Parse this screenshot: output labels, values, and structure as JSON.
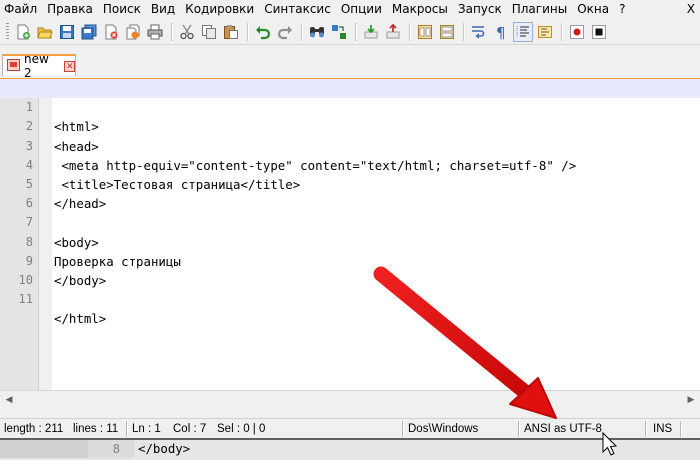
{
  "menu": {
    "items": [
      "Файл",
      "Правка",
      "Поиск",
      "Вид",
      "Кодировки",
      "Синтаксис",
      "Опции",
      "Макросы",
      "Запуск",
      "Плагины",
      "Окна",
      "?"
    ],
    "close": "X"
  },
  "toolbar": {
    "buttons": [
      "new-file-icon",
      "open-file-icon",
      "save-icon",
      "save-all-icon",
      "close-icon",
      "close-all-icon",
      "print-icon",
      "cut-icon",
      "copy-icon",
      "paste-icon",
      "undo-icon",
      "redo-icon",
      "find-icon",
      "replace-icon",
      "zoom-in-icon",
      "zoom-out-icon",
      "sync-vertical-icon",
      "sync-horizontal-icon",
      "wrap-icon",
      "show-all-chars-icon",
      "indent-guide-icon",
      "function-list-icon",
      "record-macro-icon",
      "stop-macro-icon"
    ]
  },
  "tab": {
    "label": "new  2",
    "close_glyph": "✕"
  },
  "editor": {
    "current_line": 1,
    "lines": [
      {
        "no": "1",
        "text": "<html>"
      },
      {
        "no": "2",
        "text": "<head>"
      },
      {
        "no": "3",
        "text": " <meta http-equiv=\"content-type\" content=\"text/html; charset=utf-8\" />"
      },
      {
        "no": "4",
        "text": " <title>Тестовая страница</title>"
      },
      {
        "no": "5",
        "text": "</head>"
      },
      {
        "no": "6",
        "text": ""
      },
      {
        "no": "7",
        "text": "<body>"
      },
      {
        "no": "8",
        "text": "Проверка страницы"
      },
      {
        "no": "9",
        "text": "</body>"
      },
      {
        "no": "10",
        "text": ""
      },
      {
        "no": "11",
        "text": "</html>"
      }
    ]
  },
  "status": {
    "length": "length : 211",
    "lines": "lines : 11",
    "ln": "Ln : 1",
    "col": "Col : 7",
    "sel": "Sel : 0 | 0",
    "eol": "Dos\\Windows",
    "encoding": "ANSI as UTF-8",
    "mode": "INS"
  },
  "below_window": {
    "line_no": "8",
    "text": "</body>"
  },
  "colors": {
    "tab_accent": "#f5a142",
    "current_line": "#e8e8ff",
    "arrow": "#e81010"
  }
}
